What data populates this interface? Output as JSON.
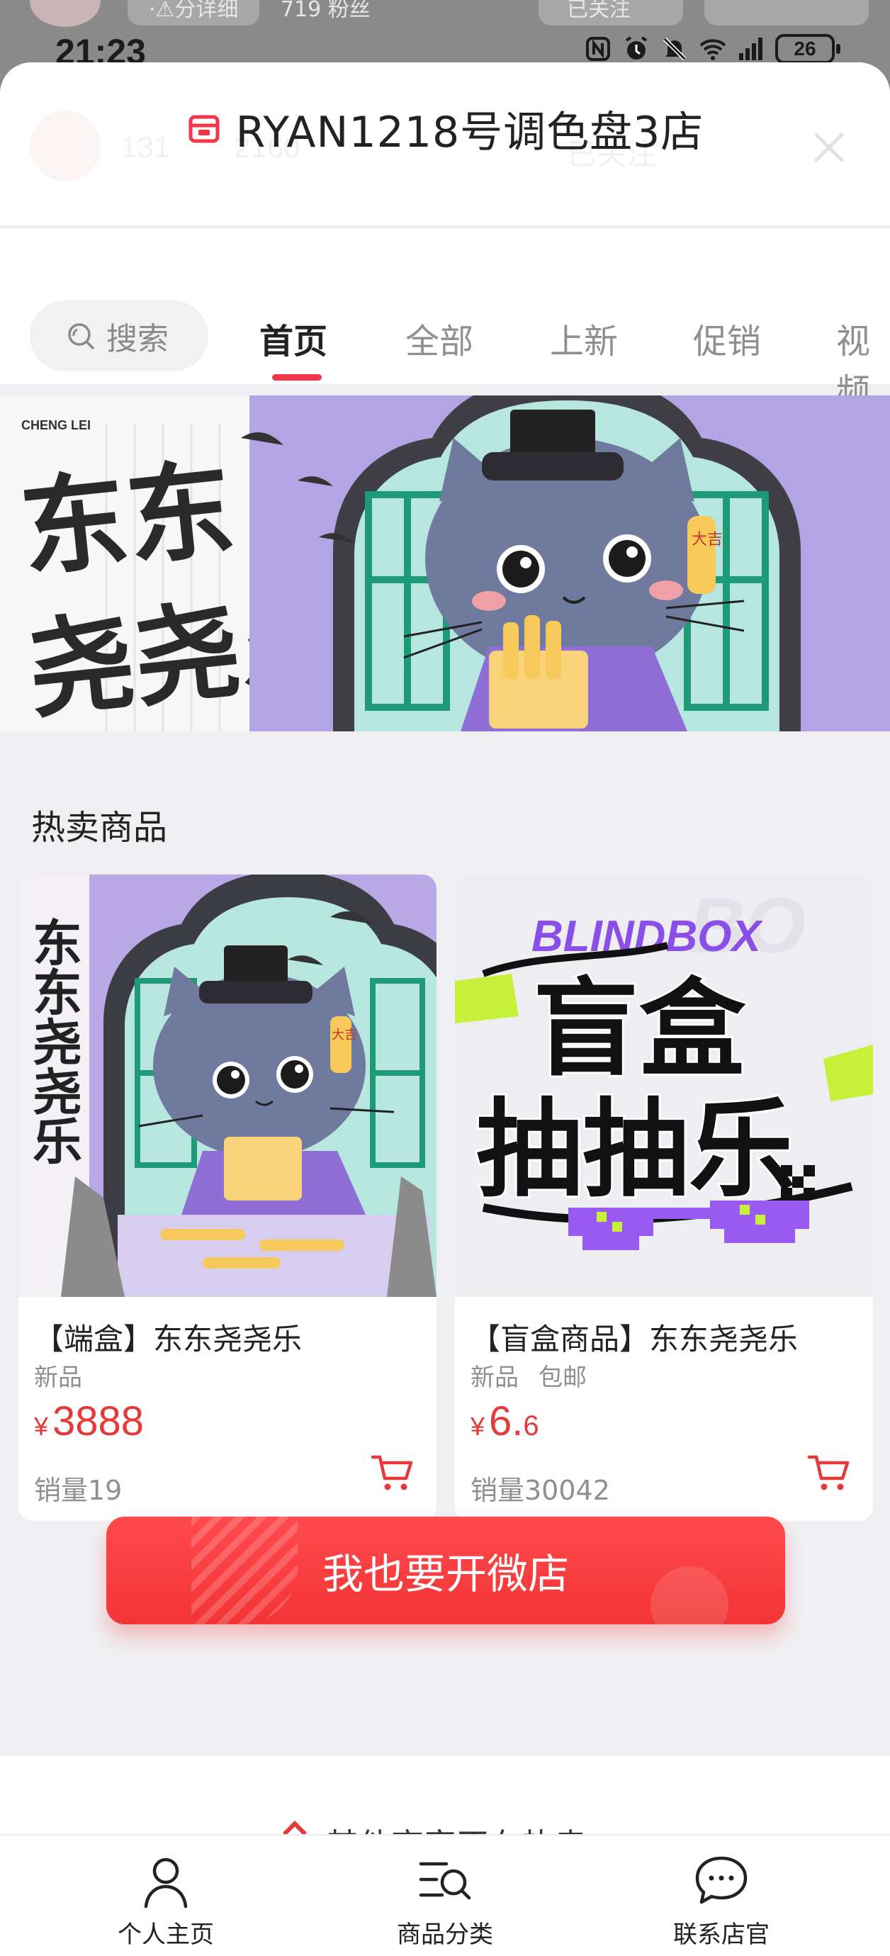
{
  "background_page": {
    "left_text": "·⚠分详细",
    "mid_text": "719 粉丝",
    "follow_button": "已关注"
  },
  "status_bar": {
    "time": "21:23",
    "battery": "26"
  },
  "sheet": {
    "ghost_id_left": "131",
    "ghost_id_right": "2160",
    "ghost_follow": "已关注",
    "shop_title": "RYAN1218号调色盘3店"
  },
  "nav_tabs": {
    "search_label": "搜索",
    "tabs": [
      "首页",
      "全部",
      "上新",
      "促销",
      "视频"
    ],
    "active_index": 0
  },
  "banner": {
    "brand_small": "CHENG LEI",
    "calligraphy_line1": "东东",
    "calligraphy_line2": "尧尧乐",
    "badge_char": "大吉"
  },
  "hot_section": {
    "title": "热卖商品",
    "products": [
      {
        "name": "【端盒】东东尧尧乐",
        "tags": [
          "新品"
        ],
        "currency": "¥",
        "price_main": "3888",
        "price_decimal": "",
        "sales": "销量19",
        "image_text_vertical": "东东尧尧乐",
        "image_badge": "大吉"
      },
      {
        "name": "【盲盒商品】东东尧尧乐",
        "tags": [
          "新品",
          "包邮"
        ],
        "currency": "¥",
        "price_main": "6.",
        "price_decimal": "6",
        "sales": "销量30042",
        "image_headline": "BLINDBOX",
        "image_line1": "盲盒",
        "image_line2": "抽抽乐"
      }
    ]
  },
  "cta": {
    "open_shop": "我也要开微店"
  },
  "peek": {
    "text": "其他商家正在热卖"
  },
  "bottom_nav": {
    "items": [
      "个人主页",
      "商品分类",
      "联系店官"
    ]
  },
  "colors": {
    "accent_red": "#f2354a",
    "price_red": "#e5393a",
    "cta_red": "#f23435"
  }
}
